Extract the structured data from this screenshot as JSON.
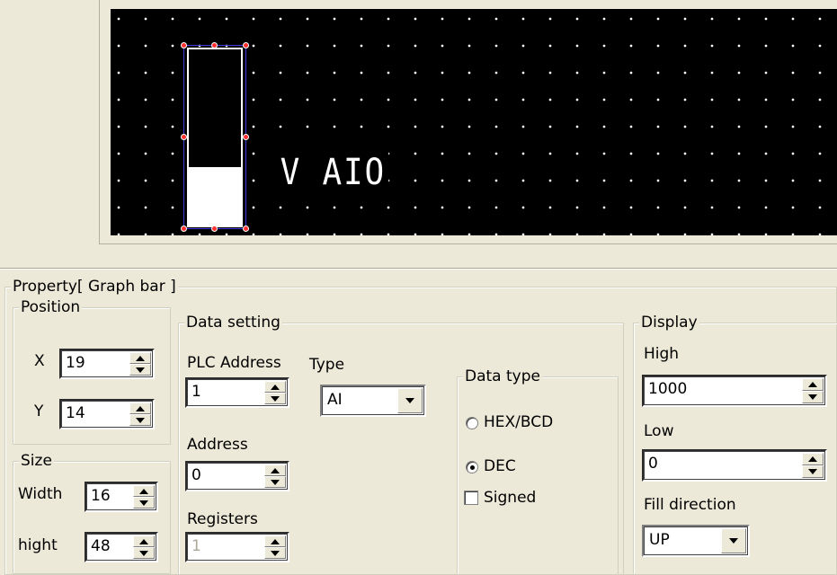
{
  "canvas": {
    "label": "V AIO",
    "bar_fill_fraction": 0.33
  },
  "panel": {
    "title": "Property[ Graph bar ]"
  },
  "position": {
    "legend": "Position",
    "x_label": "X",
    "x_value": "19",
    "y_label": "Y",
    "y_value": "14"
  },
  "size": {
    "legend": "Size",
    "width_label": "Width",
    "width_value": "16",
    "height_label": "hight",
    "height_value": "48"
  },
  "data_setting": {
    "legend": "Data setting",
    "plc_address_label": "PLC Address",
    "plc_address_value": "1",
    "type_label": "Type",
    "type_value": "AI",
    "address_label": "Address",
    "address_value": "0",
    "registers_label": "Registers",
    "registers_value": "1"
  },
  "data_type": {
    "legend": "Data type",
    "hex_label": "HEX/BCD",
    "dec_label": "DEC",
    "signed_label": "Signed",
    "selected": "DEC",
    "signed_checked": false
  },
  "display": {
    "legend": "Display",
    "high_label": "High",
    "high_value": "1000",
    "low_label": "Low",
    "low_value": "0",
    "fill_direction_label": "Fill direction",
    "fill_direction_value": "UP"
  },
  "colors": {
    "canvas_bg": "#000000",
    "window_bg": "#ece9d8",
    "handle": "#ff3030",
    "selection": "#3a3ad6"
  }
}
